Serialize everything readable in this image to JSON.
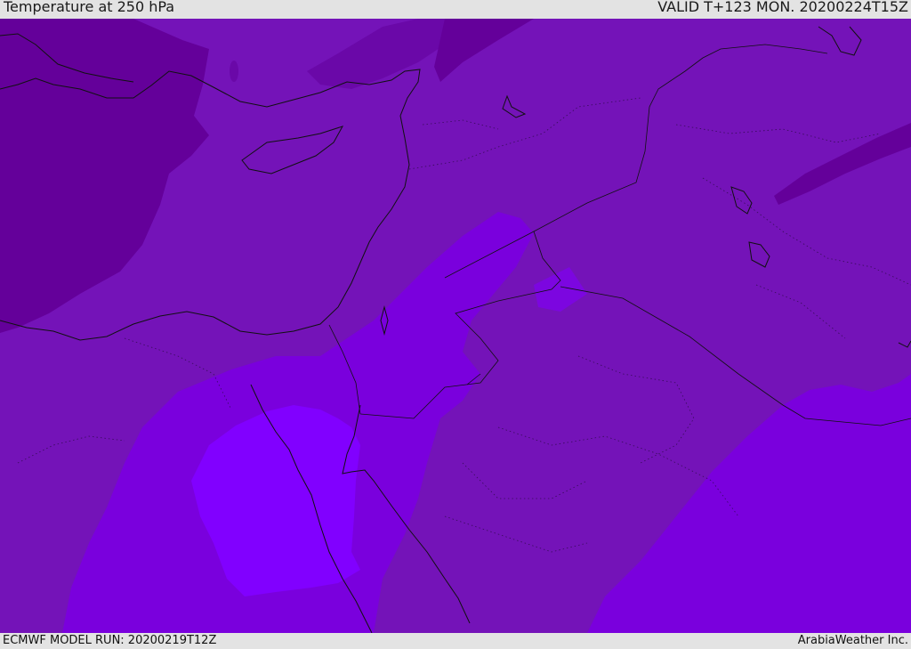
{
  "header": {
    "title": "Temperature at 250 hPa",
    "valid": "VALID T+123 MON. 20200224T15Z"
  },
  "footer": {
    "model_run": "ECMWF MODEL RUN: 20200219T12Z",
    "credit": "ArabiaWeather Inc."
  },
  "colors": {
    "coldest": "#64009a",
    "cold": "#7413b8",
    "mid": "#7a00dd",
    "warm": "#8100ff",
    "coastline": "#111111"
  }
}
